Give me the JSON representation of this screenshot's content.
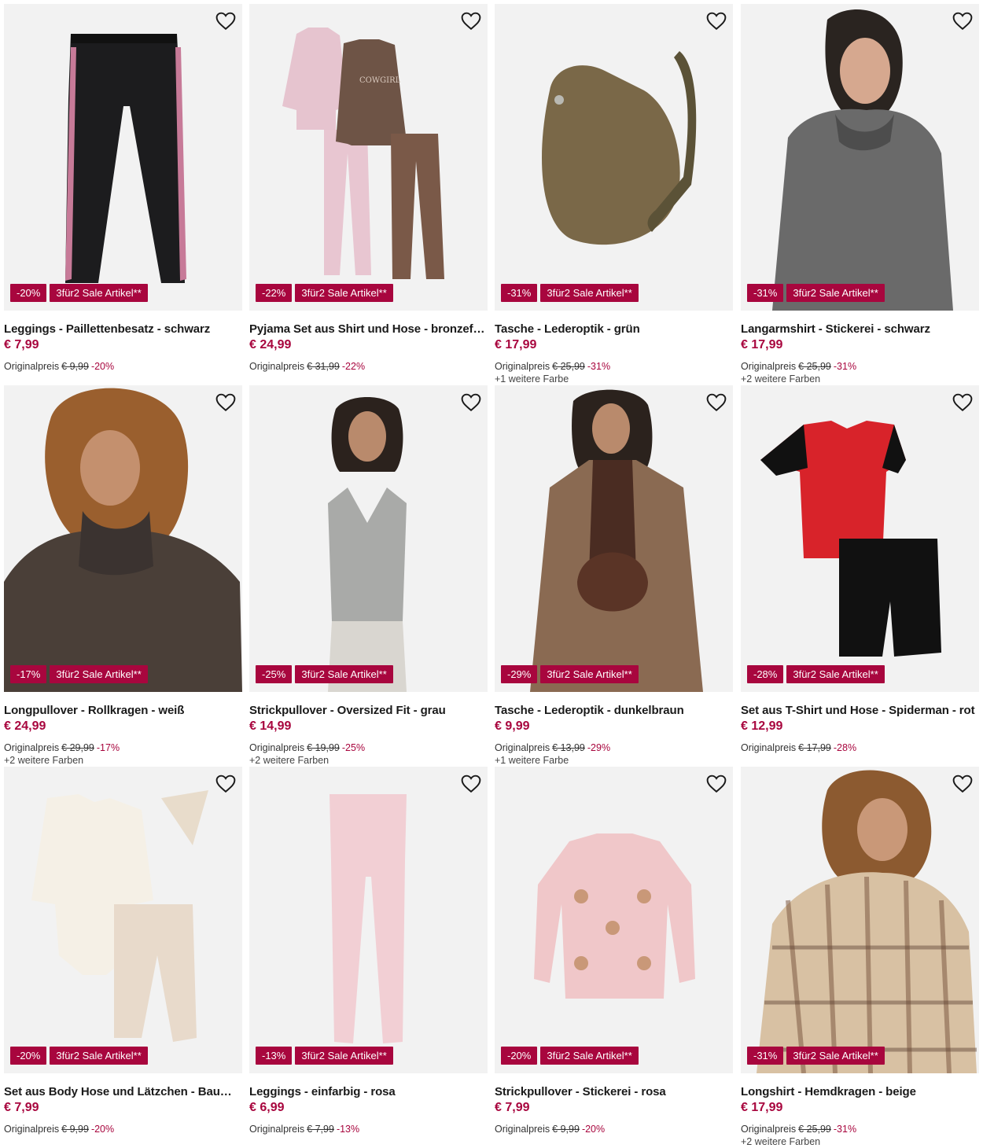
{
  "icons": {
    "wishlist": "heart-outline-icon"
  },
  "colors": {
    "accent": "#a8063e",
    "image_bg": "#f2f2f2"
  },
  "labels": {
    "original_price": "Originalpreis"
  },
  "products": [
    {
      "discount": "-20%",
      "promo": "3für2 Sale Artikel**",
      "title": "Leggings - Paillettenbesatz - schwarz",
      "price": "€ 7,99",
      "old_price": "€ 9,99",
      "old_discount": "-20%",
      "colors_note": ""
    },
    {
      "discount": "-22%",
      "promo": "3für2 Sale Artikel**",
      "title": "Pyjama Set aus Shirt und Hose - bronzefarb...",
      "price": "€ 24,99",
      "old_price": "€ 31,99",
      "old_discount": "-22%",
      "colors_note": ""
    },
    {
      "discount": "-31%",
      "promo": "3für2 Sale Artikel**",
      "title": "Tasche - Lederoptik - grün",
      "price": "€ 17,99",
      "old_price": "€ 25,99",
      "old_discount": "-31%",
      "colors_note": "+1 weitere Farbe"
    },
    {
      "discount": "-31%",
      "promo": "3für2 Sale Artikel**",
      "title": "Langarmshirt - Stickerei - schwarz",
      "price": "€ 17,99",
      "old_price": "€ 25,99",
      "old_discount": "-31%",
      "colors_note": "+2 weitere Farben"
    },
    {
      "discount": "-17%",
      "promo": "3für2 Sale Artikel**",
      "title": "Longpullover - Rollkragen - weiß",
      "price": "€ 24,99",
      "old_price": "€ 29,99",
      "old_discount": "-17%",
      "colors_note": "+2 weitere Farben"
    },
    {
      "discount": "-25%",
      "promo": "3für2 Sale Artikel**",
      "title": "Strickpullover - Oversized Fit - grau",
      "price": "€ 14,99",
      "old_price": "€ 19,99",
      "old_discount": "-25%",
      "colors_note": "+2 weitere Farben"
    },
    {
      "discount": "-29%",
      "promo": "3für2 Sale Artikel**",
      "title": "Tasche - Lederoptik - dunkelbraun",
      "price": "€ 9,99",
      "old_price": "€ 13,99",
      "old_discount": "-29%",
      "colors_note": "+1 weitere Farbe"
    },
    {
      "discount": "-28%",
      "promo": "3für2 Sale Artikel**",
      "title": "Set aus T-Shirt und Hose - Spiderman - rot",
      "price": "€ 12,99",
      "old_price": "€ 17,99",
      "old_discount": "-28%",
      "colors_note": ""
    },
    {
      "discount": "-20%",
      "promo": "3für2 Sale Artikel**",
      "title": "Set aus Body Hose und Lätzchen - Baumwo...",
      "price": "€ 7,99",
      "old_price": "€ 9,99",
      "old_discount": "-20%",
      "colors_note": ""
    },
    {
      "discount": "-13%",
      "promo": "3für2 Sale Artikel**",
      "title": "Leggings - einfarbig - rosa",
      "price": "€ 6,99",
      "old_price": "€ 7,99",
      "old_discount": "-13%",
      "colors_note": ""
    },
    {
      "discount": "-20%",
      "promo": "3für2 Sale Artikel**",
      "title": "Strickpullover - Stickerei - rosa",
      "price": "€ 7,99",
      "old_price": "€ 9,99",
      "old_discount": "-20%",
      "colors_note": ""
    },
    {
      "discount": "-31%",
      "promo": "3für2 Sale Artikel**",
      "title": "Longshirt - Hemdkragen - beige",
      "price": "€ 17,99",
      "old_price": "€ 25,99",
      "old_discount": "-31%",
      "colors_note": "+2 weitere Farben"
    }
  ]
}
